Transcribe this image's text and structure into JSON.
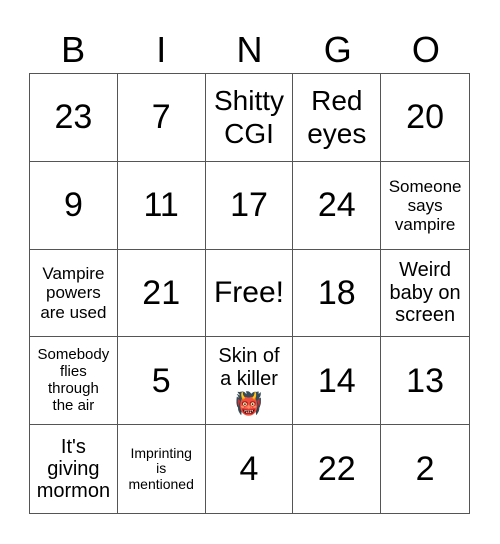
{
  "header": [
    "B",
    "I",
    "N",
    "G",
    "O"
  ],
  "cells": [
    {
      "text": "23",
      "size": "num"
    },
    {
      "text": "7",
      "size": "num"
    },
    {
      "text": "Shitty CGI",
      "size": "xl"
    },
    {
      "text": "Red eyes",
      "size": "xl"
    },
    {
      "text": "20",
      "size": "num"
    },
    {
      "text": "9",
      "size": "num"
    },
    {
      "text": "11",
      "size": "num"
    },
    {
      "text": "17",
      "size": "num"
    },
    {
      "text": "24",
      "size": "num"
    },
    {
      "text": "Someone says vampire",
      "size": "md"
    },
    {
      "text": "Vampire powers are used",
      "size": "md"
    },
    {
      "text": "21",
      "size": "num"
    },
    {
      "text": "Free!",
      "size": "free"
    },
    {
      "text": "18",
      "size": "num"
    },
    {
      "text": "Weird baby on screen",
      "size": "lg"
    },
    {
      "text": "Somebody flies through the air",
      "size": "sm"
    },
    {
      "text": "5",
      "size": "num"
    },
    {
      "text": "Skin of a killer",
      "size": "lg",
      "emoji": "👹"
    },
    {
      "text": "14",
      "size": "num"
    },
    {
      "text": "13",
      "size": "num"
    },
    {
      "text": "It's giving mormon",
      "size": "lg"
    },
    {
      "text": "Imprinting is mentioned",
      "size": "xs"
    },
    {
      "text": "4",
      "size": "num"
    },
    {
      "text": "22",
      "size": "num"
    },
    {
      "text": "2",
      "size": "num"
    }
  ],
  "cell_lines": {
    "2": [
      "Shitty",
      "CGI"
    ],
    "3": [
      "Red",
      "eyes"
    ],
    "9": [
      "Someone",
      "says",
      "vampire"
    ],
    "10": [
      "Vampire",
      "powers",
      "are used"
    ],
    "14": [
      "Weird",
      "baby on",
      "screen"
    ],
    "15": [
      "Somebody",
      "flies",
      "through",
      "the air"
    ],
    "17": [
      "Skin of",
      "a killer"
    ],
    "20": [
      "It's",
      "giving",
      "mormon"
    ],
    "21": [
      "Imprinting",
      "is",
      "mentioned"
    ]
  }
}
